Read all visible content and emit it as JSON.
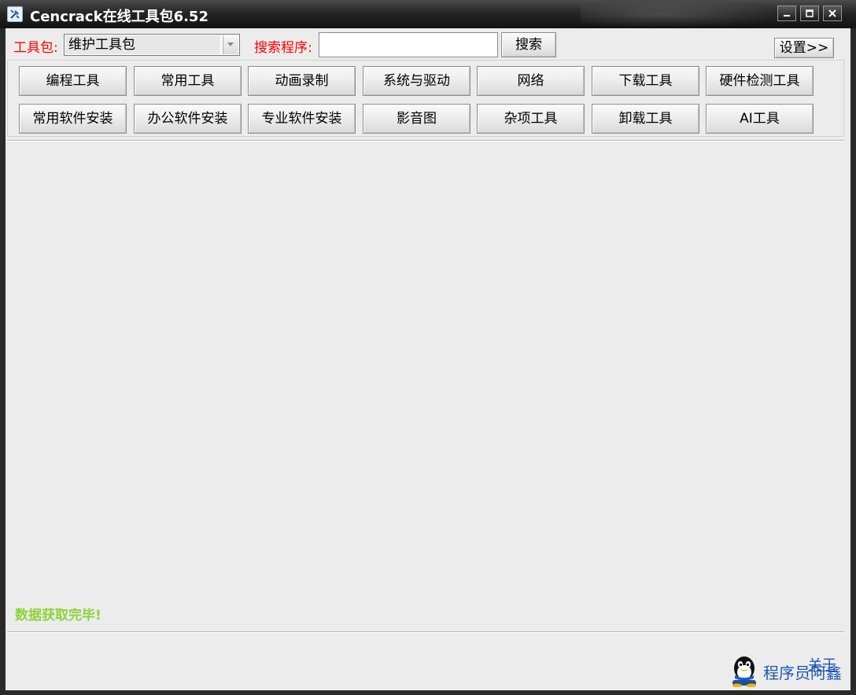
{
  "window": {
    "title": "Cencrack在线工具包6.52"
  },
  "toolbar": {
    "toolkit_label": "工具包:",
    "toolkit_selected": "维护工具包",
    "search_label": "搜索程序:",
    "search_value": "",
    "search_button": "搜索",
    "settings_button": "设置>>"
  },
  "categories": {
    "row1": [
      "编程工具",
      "常用工具",
      "动画录制",
      "系统与驱动",
      "网络",
      "下载工具",
      "硬件检测工具"
    ],
    "row2": [
      "常用软件安装",
      "办公软件安装",
      "专业软件安装",
      "影音图",
      "杂项工具",
      "卸载工具",
      "AI工具"
    ]
  },
  "status": {
    "message": "数据获取完毕!"
  },
  "footer": {
    "author": "程序员阿鑫",
    "about_link": "关于"
  },
  "colors": {
    "label_red": "#ff0000",
    "status_green": "#8bd33a",
    "link_blue": "#1a55b5"
  }
}
